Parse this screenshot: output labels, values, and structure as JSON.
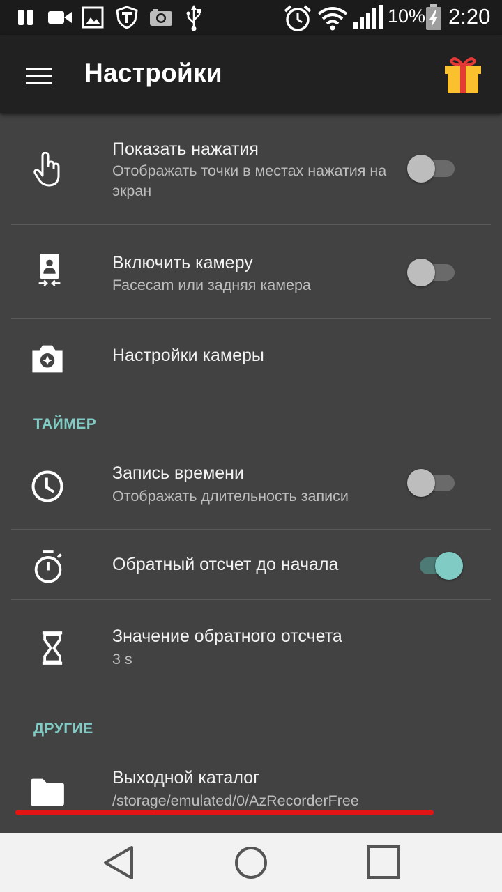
{
  "status_bar": {
    "battery_percent": "10%",
    "time": "2:20",
    "icons": [
      "pause-icon",
      "video-camera-icon",
      "image-icon",
      "shield-t-icon",
      "camera-icon",
      "usb-icon",
      "alarm-icon",
      "wifi-icon",
      "signal-icon",
      "battery-charging-icon"
    ]
  },
  "appbar": {
    "title": "Настройки",
    "menu_icon": "hamburger-menu-icon",
    "action_icon": "gift-icon"
  },
  "settings": {
    "show_touches": {
      "title": "Показать нажатия",
      "subtitle": "Отображать точки в местах нажатия на экран",
      "enabled": false,
      "icon": "touch-hand-icon"
    },
    "enable_camera": {
      "title": "Включить камеру",
      "subtitle": "Facecam или задняя камера",
      "enabled": false,
      "icon": "front-camera-icon"
    },
    "camera_settings": {
      "title": "Настройки камеры",
      "icon": "camera-settings-icon"
    },
    "timer_section": "ТАЙМЕР",
    "record_time": {
      "title": "Запись времени",
      "subtitle": "Отображать длительность записи",
      "enabled": false,
      "icon": "clock-icon"
    },
    "countdown": {
      "title": "Обратный отсчет до начала",
      "enabled": true,
      "icon": "stopwatch-icon"
    },
    "countdown_value": {
      "title": "Значение обратного отсчета",
      "subtitle": "3 s",
      "icon": "hourglass-icon"
    },
    "other_section": "ДРУГИЕ",
    "output_dir": {
      "title": "Выходной каталог",
      "subtitle": "/storage/emulated/0/AzRecorderFree",
      "icon": "folder-icon"
    }
  },
  "annotation": {
    "underline_color": "#e21414"
  },
  "colors": {
    "accent": "#80cbc4",
    "background": "#424242",
    "appbar": "#212121"
  },
  "nav_bar": {
    "buttons": [
      "back-icon",
      "home-icon",
      "recents-icon"
    ]
  }
}
